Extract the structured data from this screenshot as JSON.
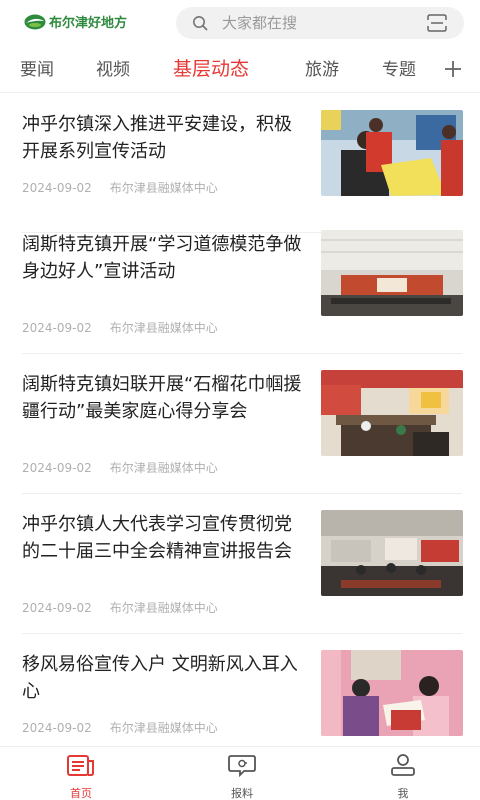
{
  "app": {
    "logo_text": "布尔津好地方"
  },
  "search": {
    "placeholder": "大家都在搜"
  },
  "tabs": [
    {
      "label": "要闻"
    },
    {
      "label": "视频"
    },
    {
      "label": "基层动态",
      "active": true
    },
    {
      "label": "旅游"
    },
    {
      "label": "专题"
    }
  ],
  "news": [
    {
      "title": "冲乎尔镇深入推进平安建设，积极开展系列宣传活动",
      "date": "2024-09-02",
      "source": "布尔津县融媒体中心"
    },
    {
      "title": "阔斯特克镇开展“学习道德模范争做身边好人”宣讲活动",
      "date": "2024-09-02",
      "source": "布尔津县融媒体中心"
    },
    {
      "title": "阔斯特克镇妇联开展“石榴花巾帼援疆行动”最美家庭心得分享会",
      "date": "2024-09-02",
      "source": "布尔津县融媒体中心"
    },
    {
      "title": "冲乎尔镇人大代表学习宣传贯彻党的二十届三中全会精神宣讲报告会",
      "date": "2024-09-02",
      "source": "布尔津县融媒体中心"
    },
    {
      "title": "移风易俗宣传入户 文明新风入耳入心",
      "date": "2024-09-02",
      "source": "布尔津县融媒体中心"
    }
  ],
  "bottom_nav": [
    {
      "label": "首页",
      "icon": "home-news-icon",
      "active": true
    },
    {
      "label": "报料",
      "icon": "tip-off-icon"
    },
    {
      "label": "我",
      "icon": "user-icon"
    }
  ],
  "colors": {
    "accent": "#e53935",
    "brand_green": "#2e8b3d"
  }
}
